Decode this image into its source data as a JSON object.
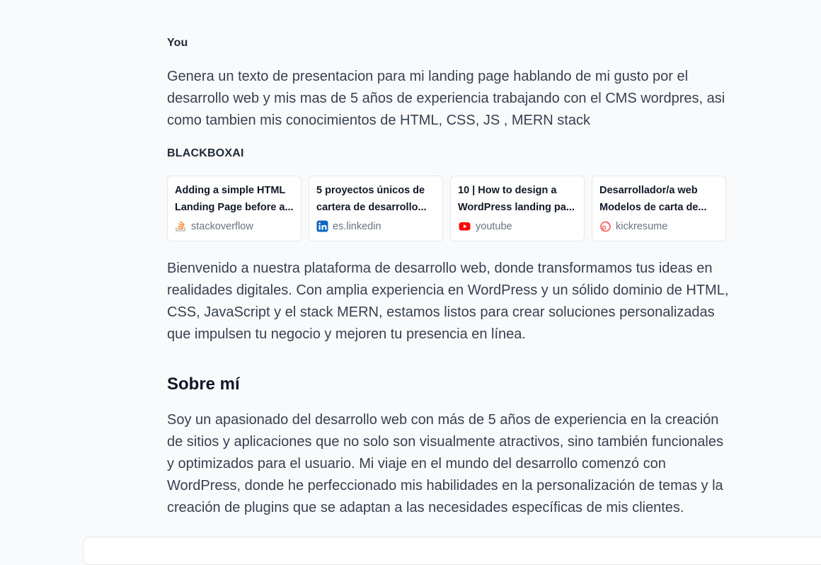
{
  "conversation": {
    "user": {
      "speaker": "You",
      "message": "Genera un texto de presentacion para mi landing page hablando de mi gusto por el desarrollo web y mis mas de 5 años de experiencia trabajando con el CMS wordpres, asi como tambien mis conocimientos de HTML, CSS, JS , MERN stack"
    },
    "assistant": {
      "speaker": "BLACKBOXAI",
      "sources": [
        {
          "title": "Adding a simple HTML Landing Page before a...",
          "site": "stackoverflow",
          "icon": "stackoverflow-icon"
        },
        {
          "title": "5 proyectos únicos de cartera de desarrollo...",
          "site": "es.linkedin",
          "icon": "linkedin-icon"
        },
        {
          "title": "10 | How to design a WordPress landing pa...",
          "site": "youtube",
          "icon": "youtube-icon"
        },
        {
          "title": "Desarrollador/a web Modelos de carta de...",
          "site": "kickresume",
          "icon": "kickresume-icon"
        }
      ],
      "intro": "Bienvenido a nuestra plataforma de desarrollo web, donde transformamos tus ideas en realidades digitales. Con amplia experiencia en WordPress y un sólido dominio de HTML, CSS, JavaScript y el stack MERN, estamos listos para crear soluciones personalizadas que impulsen tu negocio y mejoren tu presencia en línea.",
      "section_heading": "Sobre mí",
      "section_text": "Soy un apasionado del desarrollo web con más de 5 años de experiencia en la creación de sitios y aplicaciones que no solo son visualmente atractivos, sino también funcionales y optimizados para el usuario. Mi viaje en el mundo del desarrollo comenzó con WordPress, donde he perfeccionado mis habilidades en la personalización de temas y la creación de plugins que se adaptan a las necesidades específicas de mis clientes."
    }
  },
  "colors": {
    "background": "#f9fafb",
    "text": "#374151",
    "linkedin": "#0a66c2",
    "youtube": "#ff0000",
    "stackoverflow": "#f48024",
    "kickresume": "#f06a6a"
  }
}
